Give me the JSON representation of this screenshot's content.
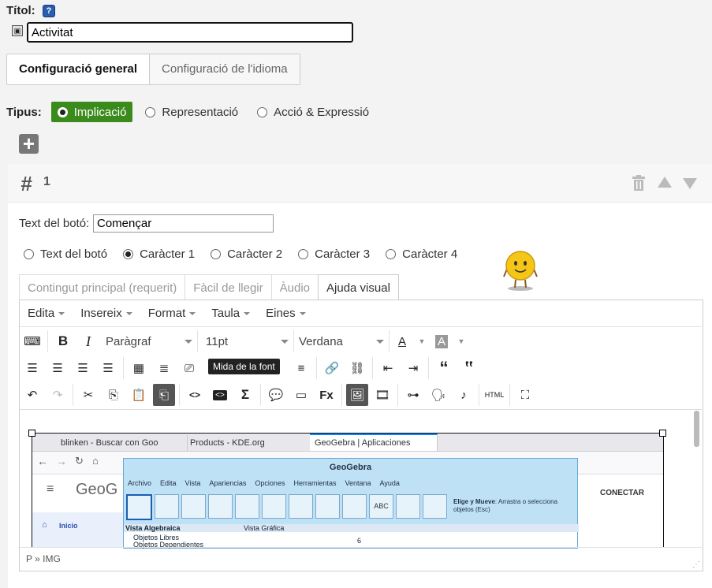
{
  "title": {
    "label": "Títol:",
    "help": "?",
    "value": "Activitat"
  },
  "tabs": [
    {
      "label": "Configuració general",
      "active": true
    },
    {
      "label": "Configuració de l'idioma",
      "active": false
    }
  ],
  "tipus": {
    "label": "Tipus:",
    "options": [
      "Implicació",
      "Representació",
      "Acció & Expressió"
    ],
    "selected": "Implicació"
  },
  "item": {
    "number": "1"
  },
  "button_text": {
    "label": "Text del botó:",
    "value": "Començar"
  },
  "character": {
    "options": [
      "Text del botó",
      "Caràcter 1",
      "Caràcter 2",
      "Caràcter 3",
      "Caràcter 4"
    ],
    "selected": "Caràcter 1"
  },
  "editor_tabs": [
    {
      "label": "Contingut principal (requerit)",
      "active": false
    },
    {
      "label": "Fàcil de llegir",
      "active": false
    },
    {
      "label": "Àudio",
      "active": false
    },
    {
      "label": "Ajuda visual",
      "active": true
    }
  ],
  "menubar": [
    "Edita",
    "Insereix",
    "Format",
    "Taula",
    "Eines"
  ],
  "toolbar": {
    "block_format": "Paràgraf",
    "font_size": "11pt",
    "font_family": "Verdana",
    "tooltip": "Mida de la font"
  },
  "statusbar": {
    "path": "P » IMG"
  },
  "embedded_screenshot": {
    "browser_tabs": [
      "blinken - Buscar con Goo",
      "Products - KDE.org",
      "GeoGebra | Aplicaciones"
    ],
    "geogebra_title": "GeoGebra",
    "geogebra_menu": [
      "Archivo",
      "Edita",
      "Vista",
      "Apariencias",
      "Opciones",
      "Herramientas",
      "Ventana",
      "Ayuda"
    ],
    "move_tool_hint_bold": "Elige y Mueve",
    "move_tool_hint": ": Arrastra o selecciona objetos (Esc)",
    "algebra_view": "Vista Algebraica",
    "graphics_view": "Vista Gráfica",
    "free_objects": "Objetos Libres",
    "dependent_objects": "Objetos Dependientes",
    "page_logo": "GeoG",
    "page_nav_home": "Inicio",
    "connect": "CONECTAR",
    "axis_tick": "6"
  },
  "colors": {
    "accent_green": "#3a8a1c",
    "help_blue": "#2a5db0",
    "geogebra_bg": "#bfe1f6"
  }
}
